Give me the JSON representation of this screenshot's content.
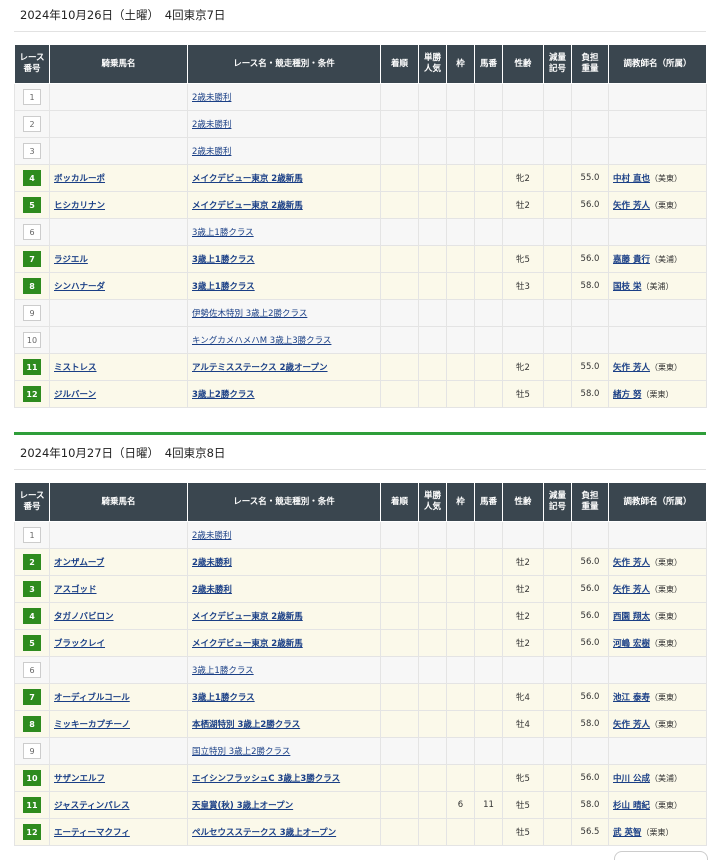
{
  "columns": [
    "レース\n番号",
    "騎乗馬名",
    "レース名・競走種別・条件",
    "着順",
    "単勝\n人気",
    "枠",
    "馬番",
    "性齢",
    "減量\n記号",
    "負担\n重量",
    "調教師名（所属）"
  ],
  "days": [
    {
      "title": "2024年10月26日（土曜）　4回東京7日",
      "rows": [
        {
          "no": "1",
          "horse": "",
          "race": "2歳未勝利",
          "rank": "",
          "pop": "",
          "frame": "",
          "uma": "",
          "sex": "",
          "gen": "",
          "weight": "",
          "trainer": "",
          "aff": ""
        },
        {
          "no": "2",
          "horse": "",
          "race": "2歳未勝利",
          "rank": "",
          "pop": "",
          "frame": "",
          "uma": "",
          "sex": "",
          "gen": "",
          "weight": "",
          "trainer": "",
          "aff": ""
        },
        {
          "no": "3",
          "horse": "",
          "race": "2歳未勝利",
          "rank": "",
          "pop": "",
          "frame": "",
          "uma": "",
          "sex": "",
          "gen": "",
          "weight": "",
          "trainer": "",
          "aff": ""
        },
        {
          "no": "4",
          "horse": "ボッカルーポ",
          "race": "メイクデビュー東京 2歳新馬",
          "rank": "",
          "pop": "",
          "frame": "",
          "uma": "",
          "sex": "牝2",
          "gen": "",
          "weight": "55.0",
          "trainer": "中村 直也",
          "aff": "（美東）"
        },
        {
          "no": "5",
          "horse": "ヒシカリナン",
          "race": "メイクデビュー東京 2歳新馬",
          "rank": "",
          "pop": "",
          "frame": "",
          "uma": "",
          "sex": "牡2",
          "gen": "",
          "weight": "56.0",
          "trainer": "矢作 芳人",
          "aff": "（栗東）"
        },
        {
          "no": "6",
          "horse": "",
          "race": "3歳上1勝クラス",
          "rank": "",
          "pop": "",
          "frame": "",
          "uma": "",
          "sex": "",
          "gen": "",
          "weight": "",
          "trainer": "",
          "aff": ""
        },
        {
          "no": "7",
          "horse": "ラジエル",
          "race": "3歳上1勝クラス",
          "rank": "",
          "pop": "",
          "frame": "",
          "uma": "",
          "sex": "牝5",
          "gen": "",
          "weight": "56.0",
          "trainer": "嘉藤 貴行",
          "aff": "（美浦）"
        },
        {
          "no": "8",
          "horse": "シンハナーダ",
          "race": "3歳上1勝クラス",
          "rank": "",
          "pop": "",
          "frame": "",
          "uma": "",
          "sex": "牡3",
          "gen": "",
          "weight": "58.0",
          "trainer": "国枝 栄",
          "aff": "（美浦）"
        },
        {
          "no": "9",
          "horse": "",
          "race": "伊勢佐木特別 3歳上2勝クラス",
          "rank": "",
          "pop": "",
          "frame": "",
          "uma": "",
          "sex": "",
          "gen": "",
          "weight": "",
          "trainer": "",
          "aff": ""
        },
        {
          "no": "10",
          "horse": "",
          "race": "キングカメハメハM 3歳上3勝クラス",
          "rank": "",
          "pop": "",
          "frame": "",
          "uma": "",
          "sex": "",
          "gen": "",
          "weight": "",
          "trainer": "",
          "aff": ""
        },
        {
          "no": "11",
          "horse": "ミストレス",
          "race": "アルテミスステークス 2歳オープン",
          "rank": "",
          "pop": "",
          "frame": "",
          "uma": "",
          "sex": "牝2",
          "gen": "",
          "weight": "55.0",
          "trainer": "矢作 芳人",
          "aff": "（栗東）"
        },
        {
          "no": "12",
          "horse": "ジルバーン",
          "race": "3歳上2勝クラス",
          "rank": "",
          "pop": "",
          "frame": "",
          "uma": "",
          "sex": "牡5",
          "gen": "",
          "weight": "58.0",
          "trainer": "緒方 努",
          "aff": "（栗東）"
        }
      ]
    },
    {
      "title": "2024年10月27日（日曜）　4回東京8日",
      "rows": [
        {
          "no": "1",
          "horse": "",
          "race": "2歳未勝利",
          "rank": "",
          "pop": "",
          "frame": "",
          "uma": "",
          "sex": "",
          "gen": "",
          "weight": "",
          "trainer": "",
          "aff": ""
        },
        {
          "no": "2",
          "horse": "オンザムーブ",
          "race": "2歳未勝利",
          "rank": "",
          "pop": "",
          "frame": "",
          "uma": "",
          "sex": "牡2",
          "gen": "",
          "weight": "56.0",
          "trainer": "矢作 芳人",
          "aff": "（栗東）"
        },
        {
          "no": "3",
          "horse": "アスゴッド",
          "race": "2歳未勝利",
          "rank": "",
          "pop": "",
          "frame": "",
          "uma": "",
          "sex": "牡2",
          "gen": "",
          "weight": "56.0",
          "trainer": "矢作 芳人",
          "aff": "（栗東）"
        },
        {
          "no": "4",
          "horse": "タガノバビロン",
          "race": "メイクデビュー東京 2歳新馬",
          "rank": "",
          "pop": "",
          "frame": "",
          "uma": "",
          "sex": "牡2",
          "gen": "",
          "weight": "56.0",
          "trainer": "西園 翔太",
          "aff": "（栗東）"
        },
        {
          "no": "5",
          "horse": "ブラックレイ",
          "race": "メイクデビュー東京 2歳新馬",
          "rank": "",
          "pop": "",
          "frame": "",
          "uma": "",
          "sex": "牡2",
          "gen": "",
          "weight": "56.0",
          "trainer": "河嶋 宏樹",
          "aff": "（栗東）"
        },
        {
          "no": "6",
          "horse": "",
          "race": "3歳上1勝クラス",
          "rank": "",
          "pop": "",
          "frame": "",
          "uma": "",
          "sex": "",
          "gen": "",
          "weight": "",
          "trainer": "",
          "aff": ""
        },
        {
          "no": "7",
          "horse": "オーディブルコール",
          "race": "3歳上1勝クラス",
          "rank": "",
          "pop": "",
          "frame": "",
          "uma": "",
          "sex": "牝4",
          "gen": "",
          "weight": "56.0",
          "trainer": "池江 泰寿",
          "aff": "（栗東）"
        },
        {
          "no": "8",
          "horse": "ミッキーカプチーノ",
          "race": "本栖湖特別 3歳上2勝クラス",
          "rank": "",
          "pop": "",
          "frame": "",
          "uma": "",
          "sex": "牡4",
          "gen": "",
          "weight": "58.0",
          "trainer": "矢作 芳人",
          "aff": "（栗東）"
        },
        {
          "no": "9",
          "horse": "",
          "race": "国立特別 3歳上2勝クラス",
          "rank": "",
          "pop": "",
          "frame": "",
          "uma": "",
          "sex": "",
          "gen": "",
          "weight": "",
          "trainer": "",
          "aff": ""
        },
        {
          "no": "10",
          "horse": "サザンエルフ",
          "race": "エイシンフラッシュC 3歳上3勝クラス",
          "rank": "",
          "pop": "",
          "frame": "",
          "uma": "",
          "sex": "牝5",
          "gen": "",
          "weight": "56.0",
          "trainer": "中川 公成",
          "aff": "（美浦）"
        },
        {
          "no": "11",
          "horse": "ジャスティンパレス",
          "race": "天皇賞(秋) 3歳上オープン",
          "rank": "",
          "pop": "",
          "frame": "6",
          "uma": "11",
          "sex": "牡5",
          "gen": "",
          "weight": "58.0",
          "trainer": "杉山 晴紀",
          "aff": "（栗東）"
        },
        {
          "no": "12",
          "horse": "エーティーマクフィ",
          "race": "ペルセウスステークス 3歳上オープン",
          "rank": "",
          "pop": "",
          "frame": "",
          "uma": "",
          "sex": "牡5",
          "gen": "",
          "weight": "56.5",
          "trainer": "武 英智",
          "aff": "（栗東）"
        }
      ]
    }
  ]
}
